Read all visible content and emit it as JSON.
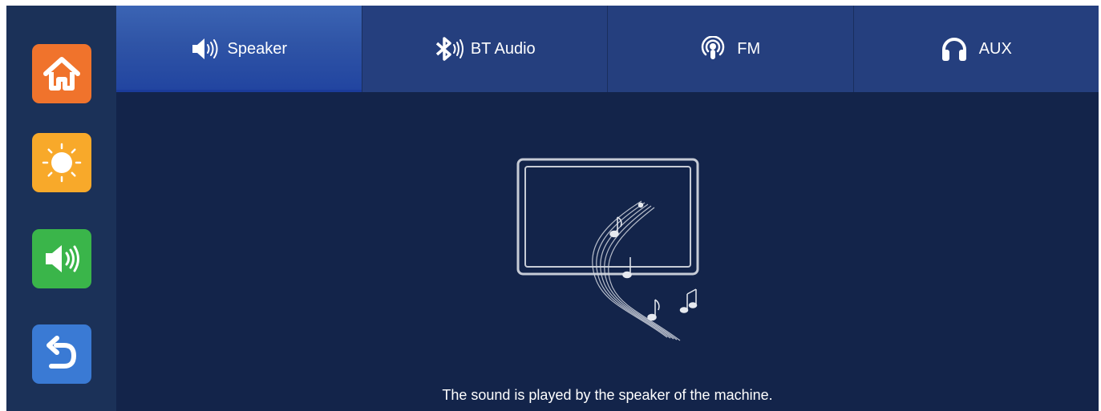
{
  "colors": {
    "background": "#13244a",
    "sidebar": "#1b3158",
    "tab": "#253f7e",
    "tab_active": "#2f54a6",
    "home_button": "#f0732c",
    "brightness_button": "#f8a92a",
    "volume_button": "#3ab54a",
    "back_button": "#3a7ad4"
  },
  "sidebar": {
    "buttons": [
      {
        "icon": "home-icon"
      },
      {
        "icon": "sun-icon"
      },
      {
        "icon": "volume-icon"
      },
      {
        "icon": "back-arrow-icon"
      }
    ]
  },
  "tabs": [
    {
      "label": "Speaker",
      "icon": "speaker-icon",
      "active": true
    },
    {
      "label": "BT Audio",
      "icon": "bluetooth-icon",
      "active": false
    },
    {
      "label": "FM",
      "icon": "radio-icon",
      "active": false
    },
    {
      "label": "AUX",
      "icon": "headphones-icon",
      "active": false
    }
  ],
  "content": {
    "illustration": "monitor-music-notes-icon",
    "caption": "The sound is played by the speaker of the machine."
  }
}
